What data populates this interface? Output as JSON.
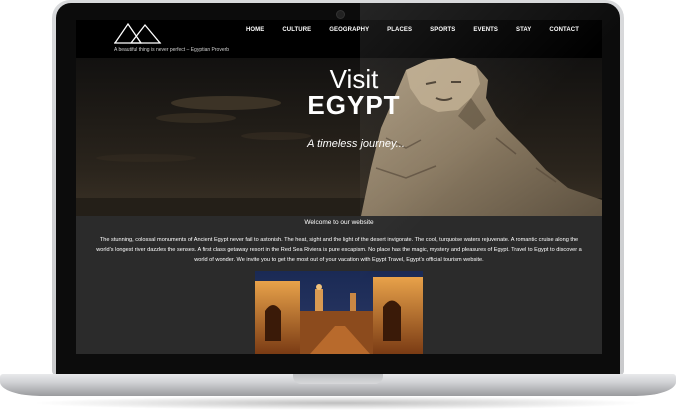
{
  "site": {
    "tagline": "A beautiful thing is never perfect – Egyptian Proverb",
    "logo_icon": "pyramids-logo-icon"
  },
  "nav": {
    "items": [
      "HOME",
      "CULTURE",
      "GEOGRAPHY",
      "PLACES",
      "SPORTS",
      "EVENTS",
      "STAY",
      "CONTACT"
    ]
  },
  "hero": {
    "title_line1": "Visit",
    "title_line2": "EGYPT",
    "subtitle": "A timeless journey..."
  },
  "main": {
    "welcome": "Welcome to our website",
    "paragraph": "The stunning, colossal monuments of Ancient Egypt never fail to astonish. The heat, sight and the light of the desert invigorate. The cool, turquoise waters rejuvenate. A romantic cruise along the world’s longest river dazzles the senses. A first class getaway resort in the Red Sea Riviera is pure escapism. No place has the magic, mystery and pleasures of Egypt. Travel to Egypt to discover a world of wonder. We invite you to get the most out of your vacation with Egypt Travel, Egypt’s official tourism website."
  },
  "colors": {
    "header_bg": "#000000",
    "content_bg": "#2b2b2b",
    "text": "#ffffff"
  }
}
